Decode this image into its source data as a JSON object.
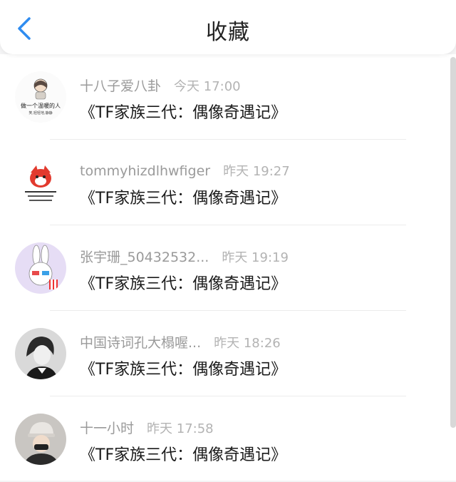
{
  "header": {
    "title": "收藏",
    "back_icon": "chevron-left-icon",
    "accent": "#2f8cf0"
  },
  "items": [
    {
      "name": "十八子爱八卦",
      "time": "今天 17:00",
      "content": "《TF家族三代：偶像奇遇记》",
      "avatar_text": "做一个温暖的人",
      "avatar_sub": "笑,轻轻地,静静"
    },
    {
      "name": "tommyhizdlhwfiger",
      "time": "昨天 19:27",
      "content": "《TF家族三代：偶像奇遇记》"
    },
    {
      "name": "张宇珊_50432532...",
      "time": "昨天 19:19",
      "content": "《TF家族三代：偶像奇遇记》"
    },
    {
      "name": "中国诗词孔大榻喔...",
      "time": "昨天 18:26",
      "content": "《TF家族三代：偶像奇遇记》"
    },
    {
      "name": "十一小时",
      "time": "昨天 17:58",
      "content": "《TF家族三代：偶像奇遇记》"
    }
  ]
}
